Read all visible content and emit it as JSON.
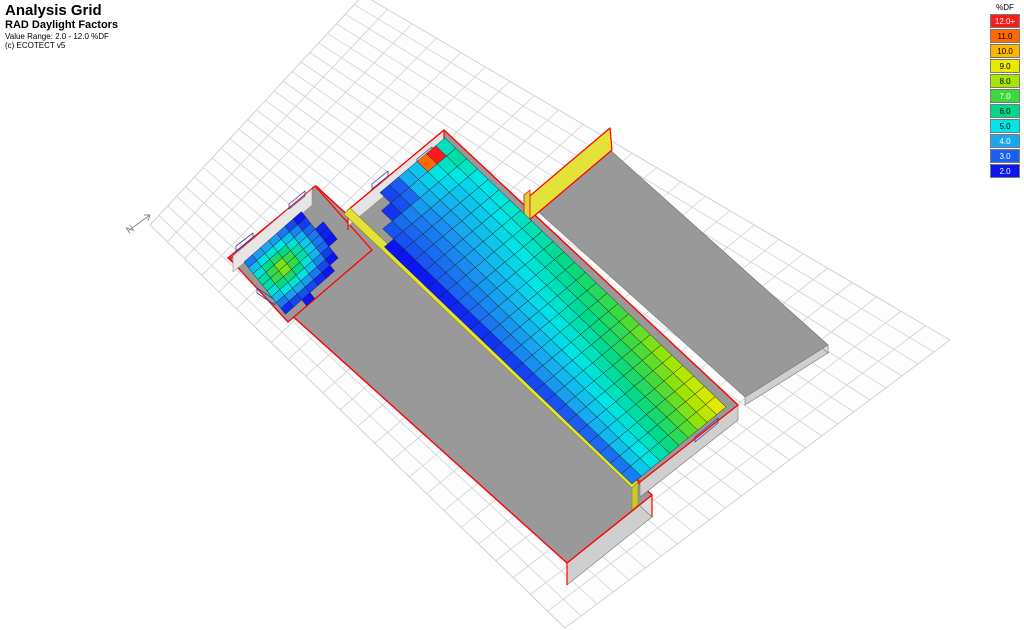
{
  "info": {
    "title": "Analysis Grid",
    "subtitle": "RAD Daylight Factors",
    "range": "Value Range: 2.0 - 12.0 %DF",
    "copyright": "(c) ECOTECT v5"
  },
  "legend": {
    "unit": "%DF",
    "entries": [
      {
        "label": "12.0+",
        "color": "#ff1a1a",
        "text": "#ffffff"
      },
      {
        "label": "11.0",
        "color": "#ff6a00",
        "text": "#000000"
      },
      {
        "label": "10.0",
        "color": "#ffb400",
        "text": "#000000"
      },
      {
        "label": "9.0",
        "color": "#eaea00",
        "text": "#000000"
      },
      {
        "label": "8.0",
        "color": "#a6e600",
        "text": "#000000"
      },
      {
        "label": "7.0",
        "color": "#3fd93f",
        "text": "#ffffff"
      },
      {
        "label": "6.0",
        "color": "#00d98c",
        "text": "#000000"
      },
      {
        "label": "5.0",
        "color": "#00e6e6",
        "text": "#000000"
      },
      {
        "label": "4.0",
        "color": "#18a8f0",
        "text": "#ffffff"
      },
      {
        "label": "3.0",
        "color": "#1a5ff0",
        "text": "#ffffff"
      },
      {
        "label": "2.0",
        "color": "#0a14f5",
        "text": "#ffffff"
      }
    ]
  },
  "north_label": "N",
  "colors": {
    "background": "#ffffff",
    "grid_line": "#d2d2d2",
    "floor": "#999999",
    "wall_front": "#cfcfcf",
    "wall_side": "#dcdcdc",
    "partition": "#e2e23a",
    "edge": "#ff0000"
  }
}
